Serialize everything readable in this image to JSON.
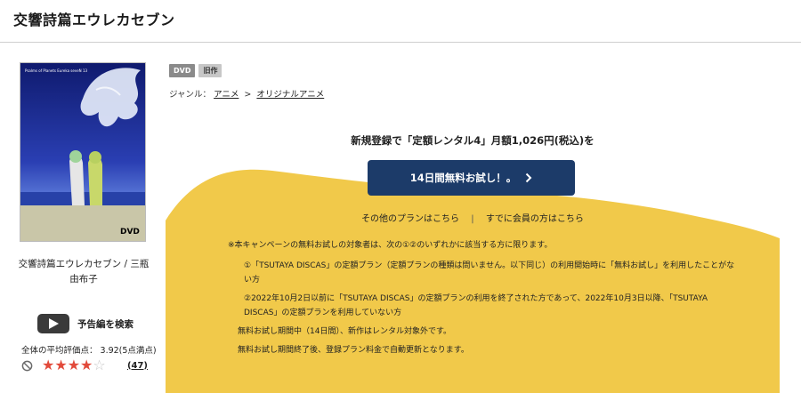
{
  "page": {
    "title": "交響詩篇エウレカセブン"
  },
  "product": {
    "cover_text": "Psalms of Planets Eureka seveN 13",
    "cover_badge": "DVD",
    "caption": "交響詩篇エウレカセブン / 三瓶由布子",
    "trailer_label": "予告編を検索",
    "rating_text": "全体の平均評価点： 3.92(5点満点)",
    "rating_value": 3.92,
    "rating_max": 5,
    "stars_filled": 4,
    "stars_total": 5,
    "review_count": "(47)",
    "tags": [
      "DVD",
      "旧作"
    ],
    "genre": {
      "label": "ジャンル：",
      "items": [
        "アニメ",
        "オリジナルアニメ"
      ],
      "separator": ">"
    }
  },
  "campaign": {
    "heading": "新規登録で「定額レンタル4」月額1,026円(税込)を",
    "cta_label": "14日間無料お試し！。",
    "other_plans": "その他のプランはこちら",
    "divider": "|",
    "members_link": "すでに会員の方はこちら",
    "notice": "※本キャンペーンの無料お試しの対象者は、次の①②のいずれかに該当する方に限ります。",
    "condition_1": "①「TSUTAYA DISCAS」の定額プラン（定額プランの種類は問いません。以下同じ）の利用開始時に「無料お試し」を利用したことがない方",
    "condition_2": "②2022年10月2日以前に「TSUTAYA DISCAS」の定額プランの利用を終了された方であって、2022年10月3日以降、「TSUTAYA DISCAS」の定額プランを利用していない方",
    "note_1": "無料お試し期間中（14日間）、新作はレンタル対象外です。",
    "note_2": "無料お試し期間終了後、登録プラン料金で自動更新となります。"
  },
  "colors": {
    "campaign_bg": "#f1c94a",
    "cta_bg": "#1c3b69",
    "star": "#e24a3b"
  }
}
